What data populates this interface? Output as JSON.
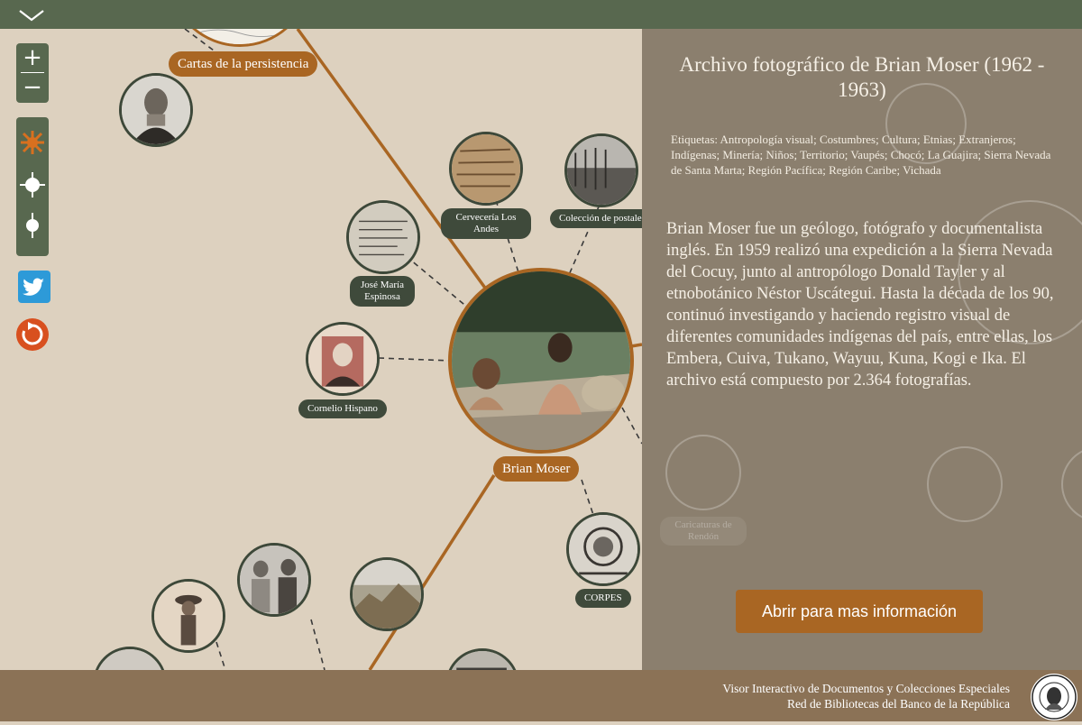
{
  "topbar": {
    "collapse_icon": "chevron-down-icon"
  },
  "toolbar": {
    "zoom_in_label": "+",
    "zoom_out_label": "−",
    "layout_icons": [
      "sun-icon",
      "crosshair-icon",
      "pin-icon"
    ],
    "twitter_icon": "twitter-icon",
    "reset_icon": "reset-icon"
  },
  "graph": {
    "outer_label": "Cartas de la persistencia",
    "center_label": "Brian Moser",
    "nodes": {
      "cerveceria": "Cervecería Los Andes",
      "coleccion_postales": "Colección de postales",
      "jose_maria": "José María Espinosa",
      "cornelio": "Cornelio Hispano",
      "corpes": "CORPES"
    }
  },
  "panel": {
    "title": "Archivo fotográfico de Brian Moser (1962 - 1963)",
    "tags": "Etiquetas: Antropología visual; Costumbres; Cultura; Etnias; Extranjeros; Indígenas; Minería; Niños; Territorio; Vaupés; Chocó; La Guajira; Sierra Nevada de Santa Marta; Región Pacífica; Región Caribe; Vichada",
    "description": "Brian Moser fue un geólogo, fotógrafo y documentalista inglés. En 1959 realizó una expedición a la Sierra Nevada del Cocuy, junto al antropólogo Donald Tayler y al etnobotánico Néstor Uscátegui. Hasta la década de los 90, continuó investigando y haciendo registro visual de diferentes comunidades indígenas del país, entre ellas, los Embera, Cuiva, Tukano, Wayuu, Kuna, Kogi e Ika. El archivo está compuesto por 2.364 fotografías.",
    "open_button": "Abrir para mas información",
    "background_label": "Caricaturas de Rendón"
  },
  "footer": {
    "line1": "Visor Interactivo de Documentos y Colecciones Especiales",
    "line2": "Red de Bibliotecas del Banco de la República",
    "seal_text": "BANCO DE LA REPÚBLICA COLOMBIA"
  },
  "colors": {
    "topbar": "#58684f",
    "canvas": "#ddd1bf",
    "panel": "#8b7f6e",
    "accent": "#a96623",
    "node_label": "#3f4a3b",
    "footer": "#8b7256"
  }
}
